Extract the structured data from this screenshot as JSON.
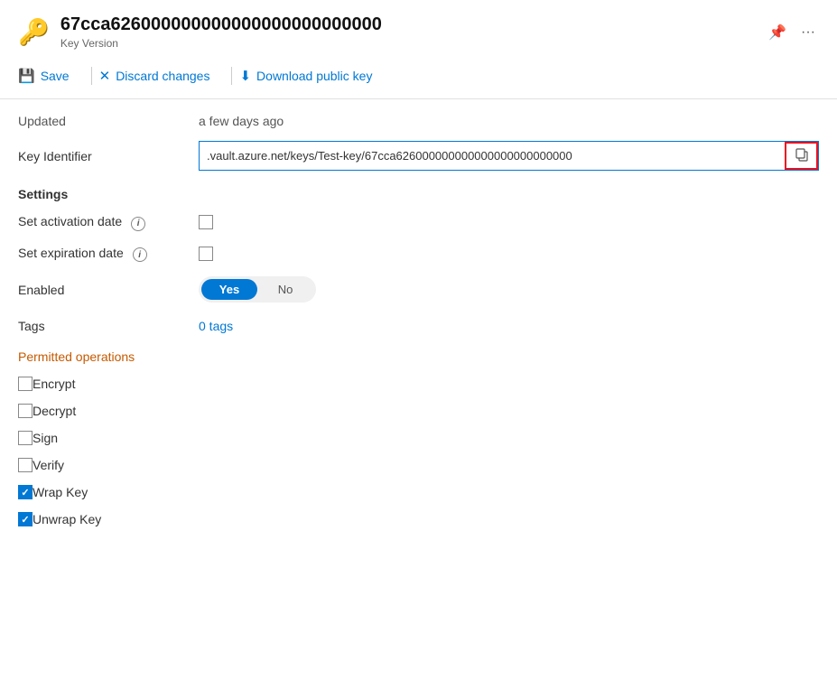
{
  "header": {
    "key_id": "67cca626000000000000000000000000",
    "key_version_label": "Key Version",
    "pin_icon": "📌",
    "more_icon": "⋯"
  },
  "toolbar": {
    "save_label": "Save",
    "discard_label": "Discard changes",
    "download_label": "Download public key"
  },
  "fields": {
    "updated_label": "Updated",
    "updated_value": "a few days ago",
    "key_identifier_label": "Key Identifier",
    "key_identifier_value": ".vault.azure.net/keys/Test-key/67cca626000000000000000000000000"
  },
  "settings": {
    "title": "Settings",
    "activation_date_label": "Set activation date",
    "expiration_date_label": "Set expiration date",
    "enabled_label": "Enabled",
    "toggle_yes": "Yes",
    "toggle_no": "No",
    "tags_label": "Tags",
    "tags_value": "0 tags"
  },
  "permitted_operations": {
    "title": "Permitted operations",
    "operations": [
      {
        "label": "Encrypt",
        "checked": false
      },
      {
        "label": "Decrypt",
        "checked": false
      },
      {
        "label": "Sign",
        "checked": false
      },
      {
        "label": "Verify",
        "checked": false
      },
      {
        "label": "Wrap Key",
        "checked": true
      },
      {
        "label": "Unwrap Key",
        "checked": true
      }
    ]
  }
}
